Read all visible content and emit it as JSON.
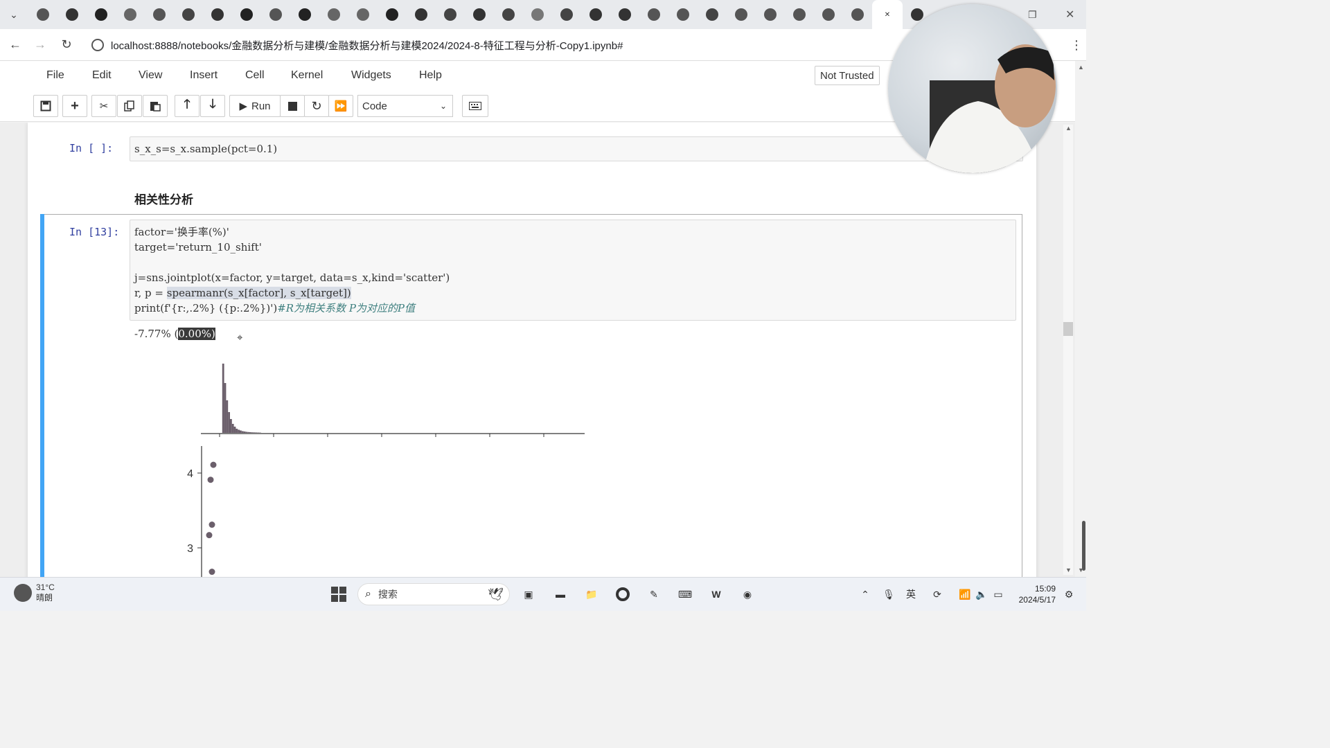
{
  "browser": {
    "url": "localhost:8888/notebooks/金融数据分析与建模/金融数据分析与建模2024/2024-8-特征工程与分析-Copy1.ipynb#",
    "tab_icons": [
      "tab-icon-media",
      "tab-icon-record",
      "tab-icon-github",
      "tab-icon-eye",
      "tab-icon-arrow",
      "tab-icon-globe",
      "tab-icon-mail",
      "tab-icon-github",
      "tab-icon-zhihu",
      "tab-icon-github",
      "tab-icon-cloud",
      "tab-icon-cloud",
      "tab-icon-github",
      "tab-icon-c",
      "tab-icon-chat",
      "tab-icon-crown",
      "tab-icon-globe",
      "tab-icon-arrow",
      "tab-icon-qq",
      "tab-icon-c",
      "tab-icon-video",
      "tab-icon-zhihu",
      "tab-icon-cloud",
      "tab-icon-cloud",
      "tab-icon-loading",
      "tab-icon-book",
      "tab-icon-book",
      "tab-icon-book",
      "tab-icon-book",
      "tab-icon-close",
      "tab-icon-baidu"
    ]
  },
  "jupyter": {
    "menu": [
      "File",
      "Edit",
      "View",
      "Insert",
      "Cell",
      "Kernel",
      "Widgets",
      "Help"
    ],
    "trusted": "Not Trusted",
    "toolbar": {
      "run_label": "Run",
      "cell_type": "Code"
    }
  },
  "cells": {
    "c1": {
      "prompt": "In [ ]:",
      "code": "s_x_s=s_x.sample(pct=0.1)"
    },
    "markdown_heading": "相关性分析",
    "c2": {
      "prompt": "In [13]:",
      "line1": "factor='换手率(%)'",
      "line2": "target='return_10_shift'",
      "line3": "j=sns.jointplot(x=factor, y=target, data=s_x,kind='scatter')",
      "line4_pre": "r, p = ",
      "line4_hl": "spearmanr(s_x[factor], s_x[target])",
      "line5_code": "print(f'{r:,.2%} ({p:.2%})')",
      "line5_comment": "#R为相关系数 P为对应的P值",
      "output_pre": "-7.77% (",
      "output_sel": "0.00%)"
    }
  },
  "chart_data": {
    "type": "scatter",
    "title": "",
    "xlabel": "",
    "ylabel": "",
    "y_ticks": [
      "4",
      "3"
    ],
    "ylim": [
      2.6,
      4.35
    ],
    "points": [
      {
        "x": 0.05,
        "y": 4.11
      },
      {
        "x": 0.03,
        "y": 3.91
      },
      {
        "x": 0.04,
        "y": 3.31
      },
      {
        "x": 0.02,
        "y": 3.17
      },
      {
        "x": 0.04,
        "y": 2.68
      }
    ],
    "marginal_x": {
      "type": "histogram",
      "density": [
        0.0,
        1.0,
        0.72,
        0.47,
        0.3,
        0.2,
        0.13,
        0.09,
        0.06,
        0.045,
        0.035,
        0.025,
        0.02,
        0.015,
        0.012,
        0.01,
        0.008,
        0.007,
        0.006,
        0.005,
        0.004,
        0.003,
        0.003,
        0.002,
        0.002,
        0.002,
        0.001,
        0.001
      ]
    }
  },
  "taskbar": {
    "weather_temp": "31°C",
    "weather_desc": "晴朗",
    "search_placeholder": "搜索",
    "time": "15:09",
    "date": "2024/5/17"
  }
}
